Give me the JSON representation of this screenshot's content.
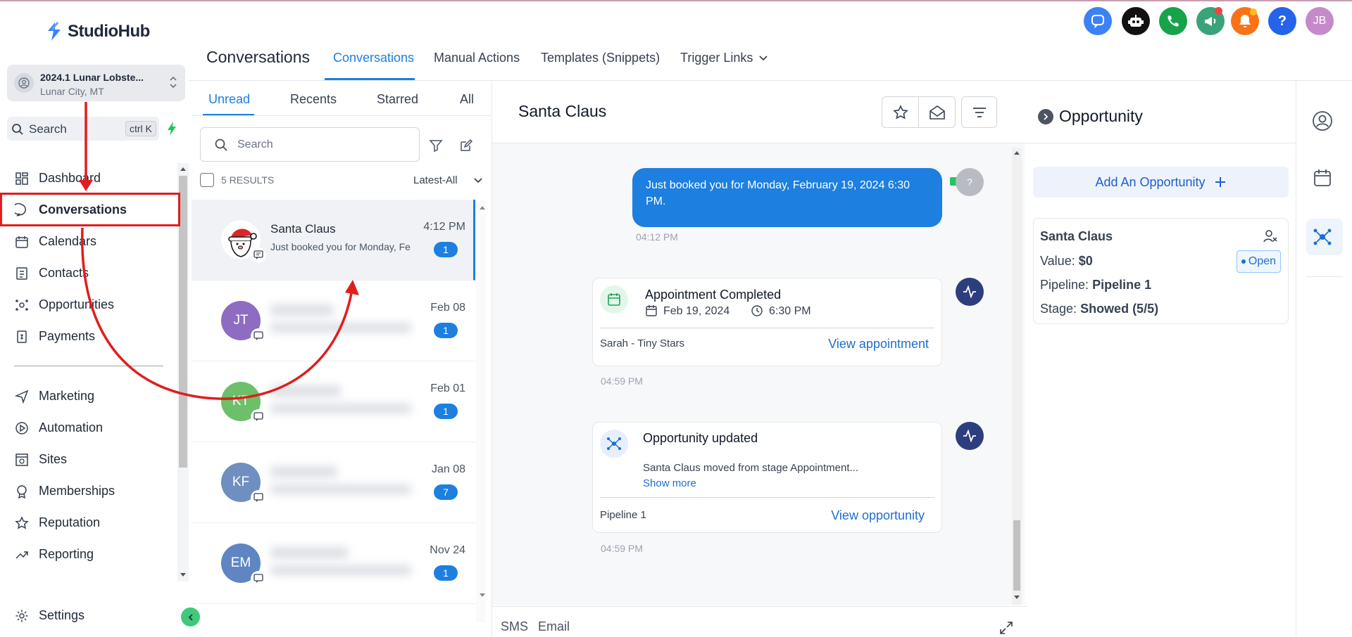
{
  "brand": {
    "name": "StudioHub"
  },
  "location": {
    "name": "2024.1 Lunar Lobste...",
    "sub": "Lunar City, MT"
  },
  "search": {
    "label": "Search",
    "shortcut": "ctrl K"
  },
  "nav": [
    {
      "label": "Dashboard"
    },
    {
      "label": "Conversations"
    },
    {
      "label": "Calendars"
    },
    {
      "label": "Contacts"
    },
    {
      "label": "Opportunities"
    },
    {
      "label": "Payments"
    },
    {
      "label": "Marketing"
    },
    {
      "label": "Automation"
    },
    {
      "label": "Sites"
    },
    {
      "label": "Memberships"
    },
    {
      "label": "Reputation"
    },
    {
      "label": "Reporting"
    },
    {
      "label": "Settings"
    }
  ],
  "header": {
    "title": "Conversations",
    "tabs": [
      "Conversations",
      "Manual Actions",
      "Templates (Snippets)",
      "Trigger Links"
    ],
    "user_initials": "JB"
  },
  "list": {
    "tabs": [
      "Unread",
      "Recents",
      "Starred",
      "All"
    ],
    "search_placeholder": "Search",
    "results": "5 RESULTS",
    "sort": "Latest-All",
    "items": [
      {
        "initials": "",
        "name": "Santa Claus",
        "preview": "Just booked you for Monday, Fe",
        "time": "4:12 PM",
        "count": "1",
        "color": ""
      },
      {
        "initials": "JT",
        "name": "",
        "preview": "",
        "time": "Feb 08",
        "count": "1",
        "color": "#8e6cc2"
      },
      {
        "initials": "KT",
        "name": "",
        "preview": "",
        "time": "Feb 01",
        "count": "1",
        "color": "#6dbf6a"
      },
      {
        "initials": "KF",
        "name": "",
        "preview": "",
        "time": "Jan 08",
        "count": "7",
        "color": "#6f8fc0"
      },
      {
        "initials": "EM",
        "name": "",
        "preview": "",
        "time": "Nov 24",
        "count": "1",
        "color": "#5f86c2"
      }
    ]
  },
  "chat": {
    "contact": "Santa Claus",
    "bubble_text": "Just booked you for Monday, February 19, 2024 6:30 PM.",
    "bubble_time": "04:12 PM",
    "avatar_q": "?",
    "appointment": {
      "title": "Appointment Completed",
      "date": "Feb 19, 2024",
      "time": "6:30 PM",
      "calendar": "Sarah - Tiny Stars",
      "link": "View appointment",
      "ts": "04:59 PM"
    },
    "opportunity": {
      "title": "Opportunity updated",
      "detail": "Santa Claus moved from stage Appointment...",
      "more": "Show more",
      "pipeline": "Pipeline 1",
      "link": "View opportunity",
      "ts": "04:59 PM"
    },
    "footer_tabs": [
      "SMS",
      "Email"
    ]
  },
  "opportunity_panel": {
    "title": "Opportunity",
    "add_label": "Add An Opportunity",
    "card": {
      "name": "Santa Claus",
      "value_label": "Value:",
      "value": "$0",
      "status": "Open",
      "pipeline_label": "Pipeline:",
      "pipeline": "Pipeline 1",
      "stage_label": "Stage:",
      "stage": "Showed (5/5)"
    }
  },
  "colors": {
    "accent": "#1d7fe0",
    "annotation": "#e11d1d"
  }
}
